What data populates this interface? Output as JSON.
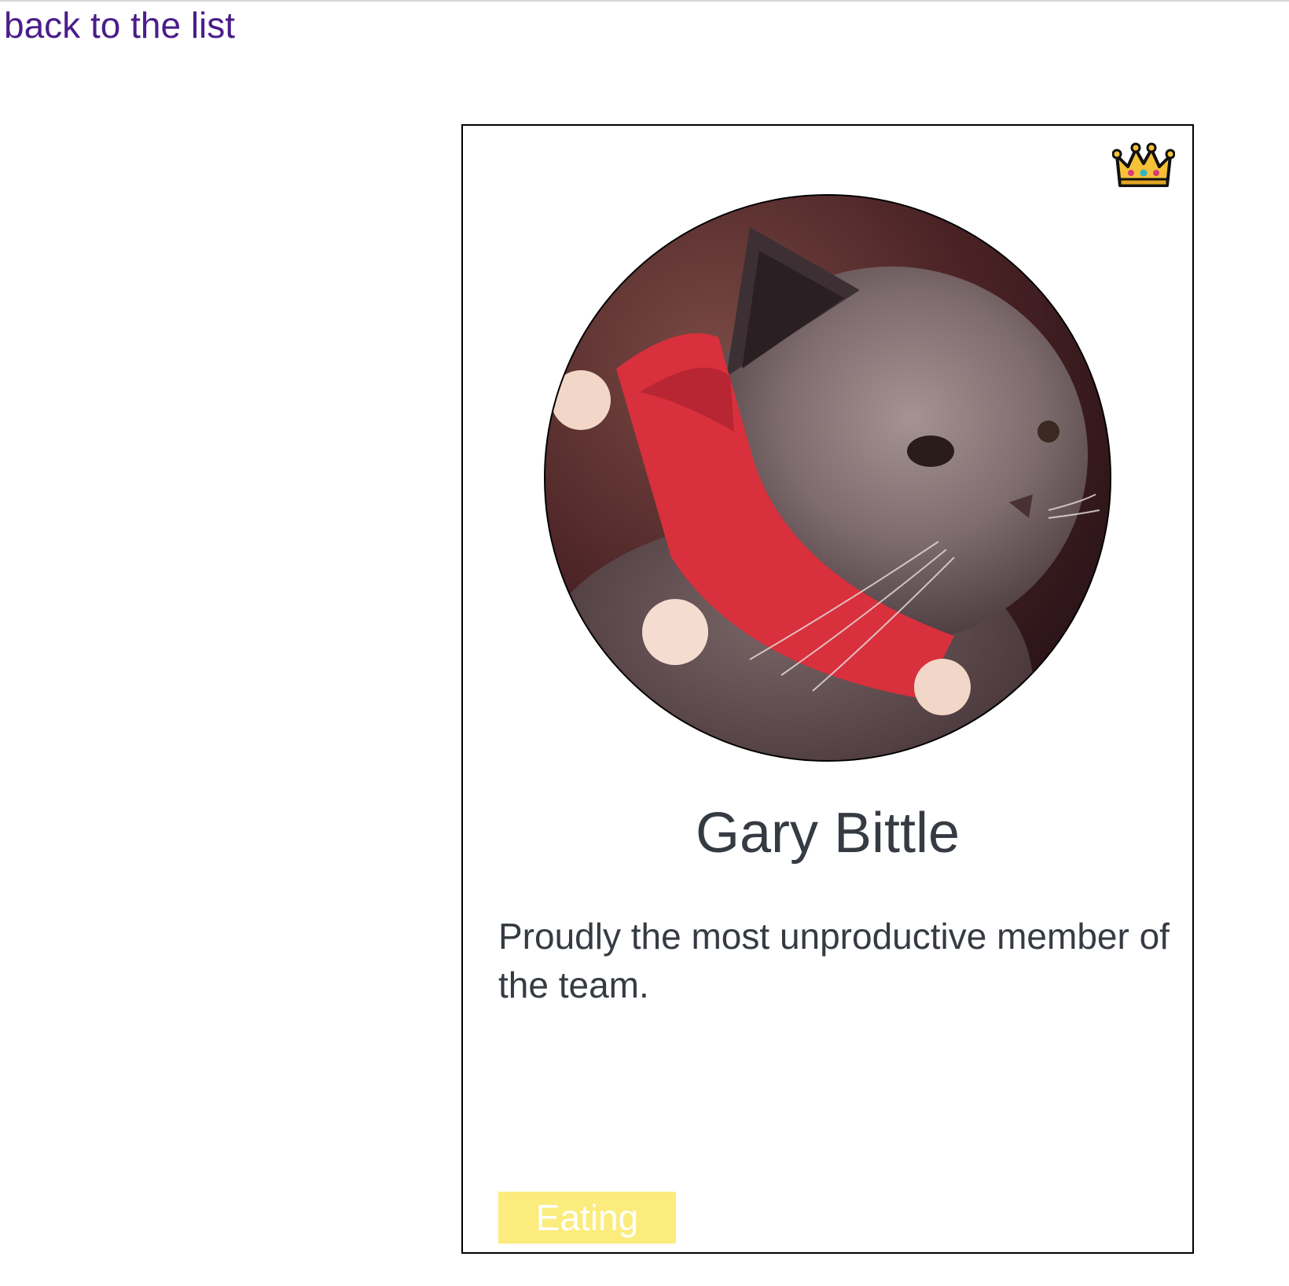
{
  "nav": {
    "back_label": "back to the list"
  },
  "member": {
    "name": "Gary Bittle",
    "bio": "Proudly the most unproductive member of the team.",
    "status": "Eating",
    "badge_icon": "crown-icon",
    "photo_alt": "Gary Bittle"
  },
  "colors": {
    "link": "#4b1d8a",
    "text": "#363b43",
    "status_bg": "#fbec7d",
    "status_text": "#ffffff",
    "border": "#000000"
  }
}
